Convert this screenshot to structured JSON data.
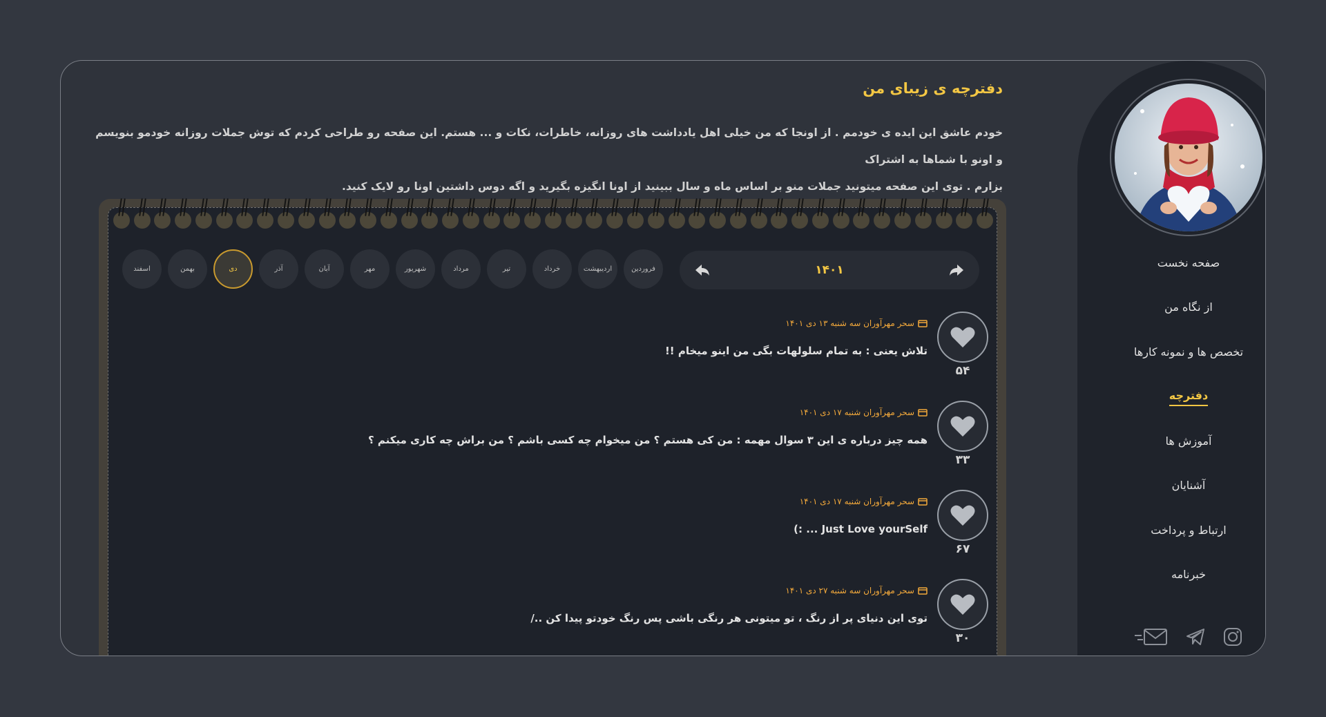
{
  "header": {
    "title": "دفترچه ی زیبای من",
    "intro_line1": "خودم عاشق این ایده ی خودمم . از اونجا که من خیلی اهل یادداشت های روزانه، خاطرات، نکات و ... هستم. این صفحه رو طراحی کردم که توش جملات روزانه خودمو بنویسم و اونو با شماها به اشتراک",
    "intro_line2": "بزارم . توی این صفحه میتونید جملات منو بر اساس ماه و سال ببینید از اونا انگیزه بگیرید و اگه دوس داشتین اونا رو لایک کنید."
  },
  "sidebar": {
    "nav": [
      {
        "label": "صفحه نخست"
      },
      {
        "label": "از نگاه من"
      },
      {
        "label": "تخصص ها و نمونه کارها"
      },
      {
        "label": "دفترچه",
        "active": true
      },
      {
        "label": "آموزش ها"
      },
      {
        "label": "آشنایان"
      },
      {
        "label": "ارتباط و پرداخت"
      },
      {
        "label": "خبرنامه"
      }
    ],
    "socials": [
      "mail-icon",
      "telegram-icon",
      "instagram-icon"
    ]
  },
  "calendar": {
    "year": "۱۴۰۱",
    "months": [
      "اسفند",
      "بهمن",
      "دی",
      "آذر",
      "آبان",
      "مهر",
      "شهریور",
      "مرداد",
      "تیر",
      "خرداد",
      "اردیبهشت",
      "فروردین"
    ],
    "active_month": "دی"
  },
  "posts": [
    {
      "meta": "سحر مهرآوران سه شنبه ۱۳ دی ۱۴۰۱",
      "text": "تلاش یعنی : به تمام سلولهات بگی من اینو میخام !!",
      "likes": "۵۴"
    },
    {
      "meta": "سحر مهرآوران شنبه ۱۷ دی ۱۴۰۱",
      "text": "همه چیز درباره ی این ۳ سوال مهمه : من کی هستم ؟ من میخوام چه کسی باشم ؟ من براش چه کاری میکنم ؟",
      "likes": "۳۳"
    },
    {
      "meta": "سحر مهرآوران شنبه ۱۷ دی ۱۴۰۱",
      "text": "Just Love yourSelf ... :)",
      "likes": "۶۷"
    },
    {
      "meta": "سحر مهرآوران سه شنبه ۲۷ دی ۱۴۰۱",
      "text": "توی این دنیای پر از رنگ ، تو میتونی هر رنگی باشی پس رنگ خودتو پیدا کن ../",
      "likes": "۳۰"
    }
  ],
  "colors": {
    "accent": "#f3c744",
    "meta": "#f3a93b",
    "background": "#333740",
    "panel": "#1f232b"
  }
}
